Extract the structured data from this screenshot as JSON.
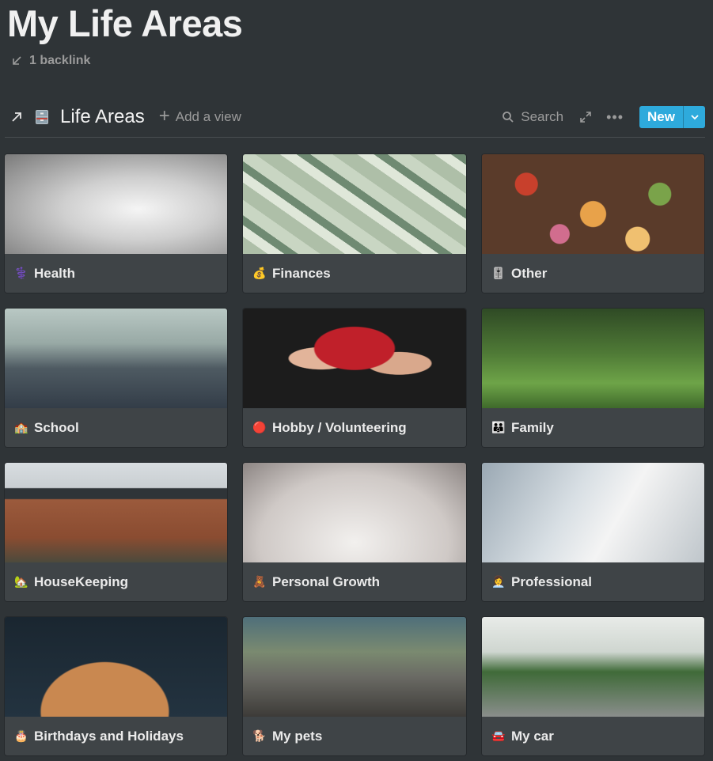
{
  "page": {
    "title": "My Life Areas",
    "backlink": "1 backlink"
  },
  "database": {
    "title": "Life Areas",
    "add_view": "Add a view",
    "search": "Search",
    "new_button": "New",
    "icon": "file-cabinet-icon"
  },
  "cards": [
    {
      "title": "Health",
      "emoji": "⚕️",
      "cover": "stethoscope"
    },
    {
      "title": "Finances",
      "emoji": "💰",
      "cover": "dollar-bills"
    },
    {
      "title": "Other",
      "emoji": "🎚️",
      "cover": "food-spread"
    },
    {
      "title": "School",
      "emoji": "🏫",
      "cover": "classroom"
    },
    {
      "title": "Hobby / Volunteering",
      "emoji": "🔴",
      "cover": "painted-hands"
    },
    {
      "title": "Family",
      "emoji": "👪",
      "cover": "family-with-dog"
    },
    {
      "title": "HouseKeeping",
      "emoji": "🏡",
      "cover": "brick-houses"
    },
    {
      "title": "Personal Growth",
      "emoji": "🧸",
      "cover": "seedling"
    },
    {
      "title": "Professional",
      "emoji": "👩‍💼",
      "cover": "laptop-desk"
    },
    {
      "title": "Birthdays and Holidays",
      "emoji": "🎂",
      "cover": "birthday-cake"
    },
    {
      "title": "My pets",
      "emoji": "🐕",
      "cover": "puppies"
    },
    {
      "title": "My car",
      "emoji": "🚘",
      "cover": "orange-beetle"
    }
  ],
  "colors": {
    "background": "#2f3437",
    "card": "#3f4447",
    "accent": "#2eaadc"
  }
}
